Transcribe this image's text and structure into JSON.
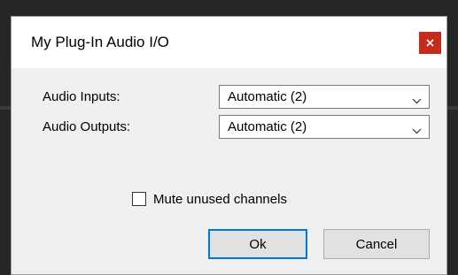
{
  "window": {
    "title": "My Plug-In Audio I/O",
    "close_glyph": "x"
  },
  "rows": [
    {
      "label": "Audio Inputs:",
      "value": "Automatic (2)"
    },
    {
      "label": "Audio Outputs:",
      "value": "Automatic (2)"
    }
  ],
  "mute_unused": {
    "label": "Mute unused channels",
    "checked": false
  },
  "buttons": {
    "ok_label": "Ok",
    "cancel_label": "Cancel"
  },
  "colors": {
    "close_button": "#c42b1c",
    "default_button_border": "#0078d7"
  },
  "icons": {
    "close": "close-icon",
    "dropdown": "chevron-down-icon"
  }
}
